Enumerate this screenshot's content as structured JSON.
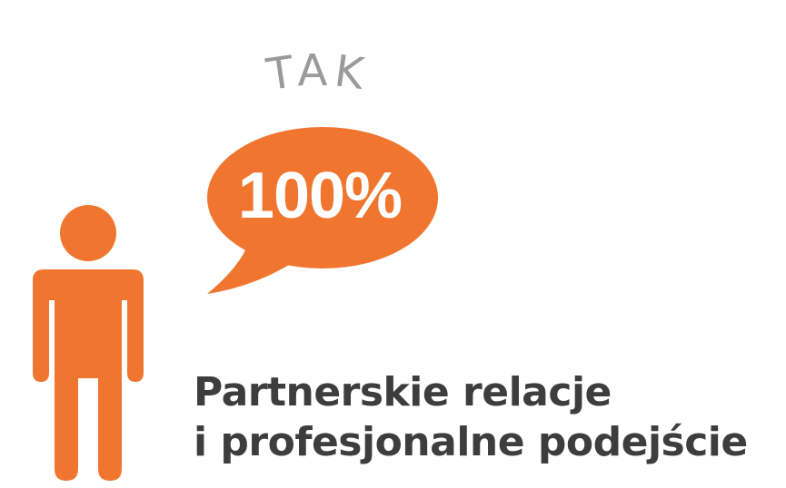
{
  "arc_label": "TAK",
  "bubble": {
    "value": "100%",
    "color": "#f07630"
  },
  "person": {
    "color": "#f07630",
    "icon": "person-icon"
  },
  "caption": {
    "line1": "Partnerskie relacje",
    "line2": "i profesjonalne podejście",
    "color": "#3d3d3d"
  }
}
